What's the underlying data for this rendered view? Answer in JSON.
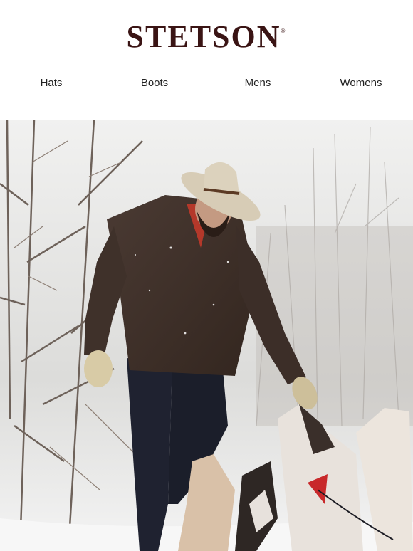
{
  "brand": {
    "name": "STETSON",
    "mark": "®",
    "color": "#3a1414"
  },
  "nav": {
    "items": [
      {
        "label": "Hats"
      },
      {
        "label": "Boots"
      },
      {
        "label": "Mens"
      },
      {
        "label": "Womens"
      }
    ]
  },
  "hero": {
    "icon": "photo-man-with-husky-dogs-in-snow"
  }
}
